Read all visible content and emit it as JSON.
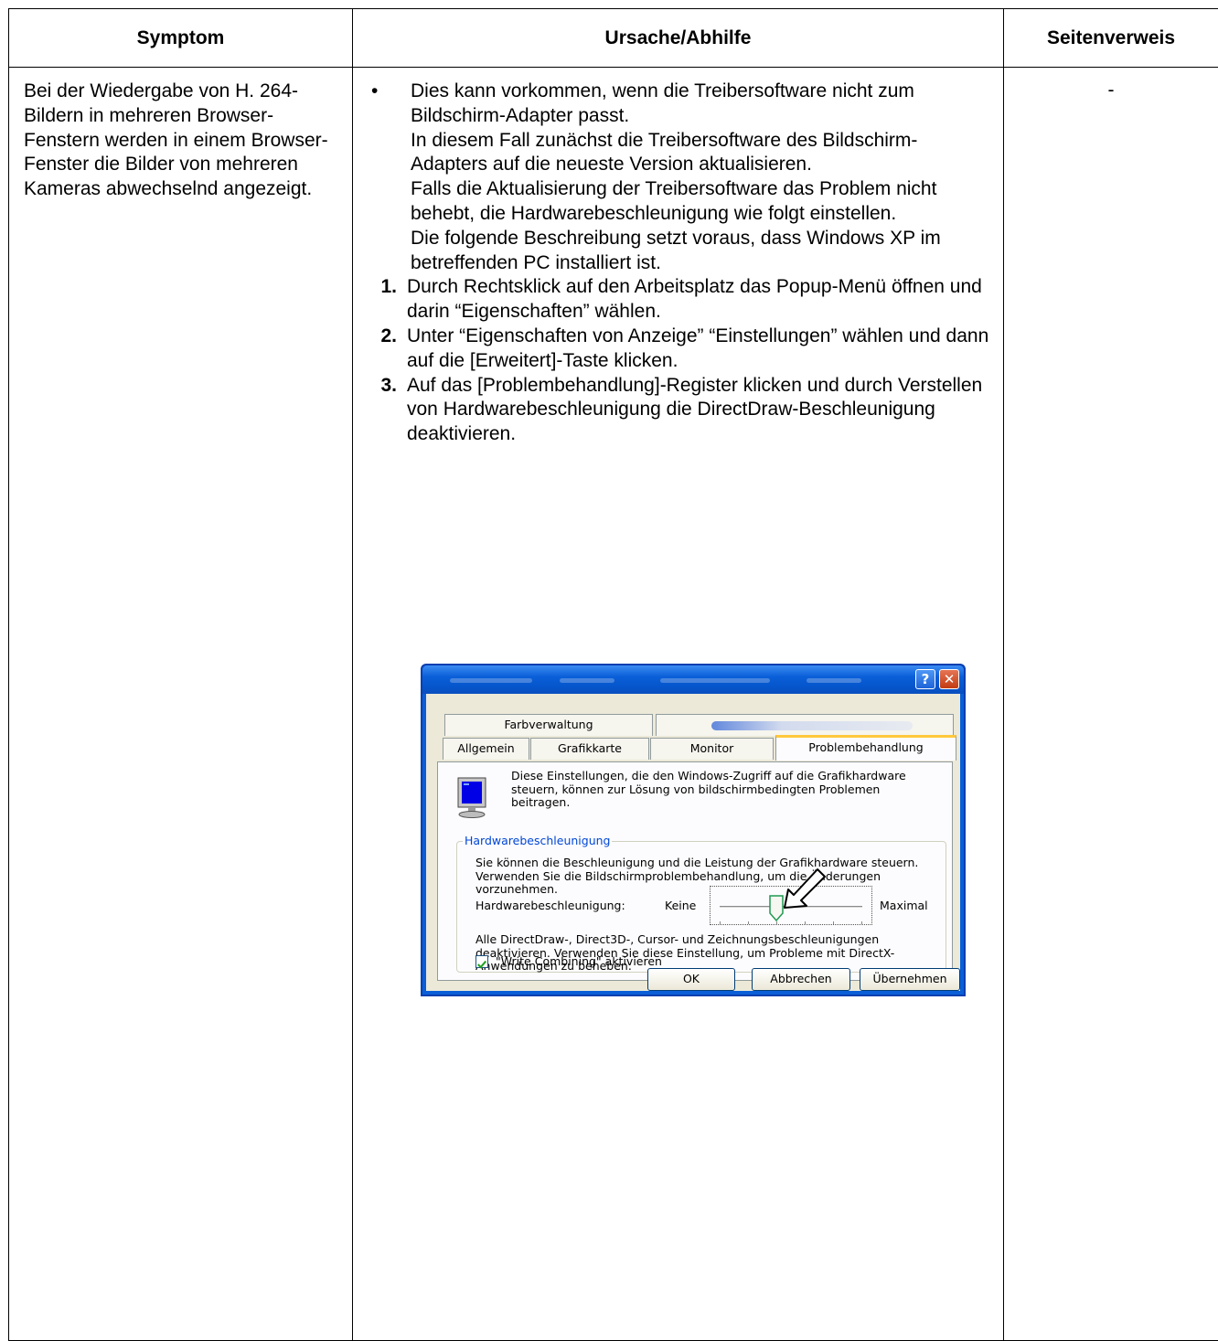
{
  "table": {
    "headers": {
      "symptom": "Symptom",
      "cause": "Ursache/Abhilfe",
      "reference": "Seitenverweis"
    },
    "row": {
      "symptom": "Bei der Wiedergabe von H. 264-Bildern in mehreren Browser-Fenstern werden in einem Browser-Fenster die Bilder von mehreren Kameras abwechselnd angezeigt.",
      "bullet": "•",
      "cause_paragraphs": [
        "Dies kann vorkommen, wenn die Treibersoftware nicht zum Bildschirm-Adapter passt.",
        "In diesem Fall zunächst die Treibersoftware des Bildschirm-Adapters auf die neueste Version aktualisieren.",
        "Falls die Aktualisierung der Treibersoftware das Problem nicht behebt, die Hardwarebeschleunigung wie folgt einstellen.",
        "Die folgende Beschreibung setzt voraus, dass Windows XP im betreffenden PC installiert ist."
      ],
      "steps": [
        {
          "num": "1.",
          "text": "Durch Rechtsklick auf den Arbeitsplatz das Popup-Menü öffnen und darin “Eigenschaften” wählen."
        },
        {
          "num": "2.",
          "text": "Unter “Eigenschaften von Anzeige” “Einstellungen” wählen und dann auf die [Erweitert]-Taste klicken."
        },
        {
          "num": "3.",
          "text": "Auf das [Problembehandlung]-Register klicken und durch Verstellen von Hardwarebeschleunigung die DirectDraw-Beschleunigung deaktivieren."
        }
      ],
      "reference": "-"
    }
  },
  "dialog": {
    "title_buttons": {
      "help": "?",
      "close": "✕"
    },
    "tabs_top": [
      "Farbverwaltung",
      ""
    ],
    "tabs_bottom": [
      "Allgemein",
      "Grafikkarte",
      "Monitor",
      "Problembehandlung"
    ],
    "active_tab": "Problembehandlung",
    "intro": "Diese Einstellungen, die den Windows-Zugriff auf die Grafikhardware steuern, können zur Lösung von bildschirmbedingten Problemen beitragen.",
    "group_title": "Hardwarebeschleunigung",
    "group_text": "Sie können die Beschleunigung und die Leistung der Grafikhardware steuern. Verwenden Sie die Bildschirmproblembehandlung, um die Änderungen vorzunehmen.",
    "accel_label": "Hardwarebeschleunigung:",
    "slider_min_label": "Keine",
    "slider_max_label": "Maximal",
    "slider_level": 0.4,
    "disable_text": "Alle DirectDraw-, Direct3D-, Cursor- und Zeichnungsbeschleunigungen deaktivieren. Verwenden Sie diese Einstellung, um Probleme mit DirectX-Anwendungen zu beheben.",
    "write_combining_label": "\"Write Combining\" aktivieren",
    "write_combining_checked": true,
    "buttons": {
      "ok": "OK",
      "cancel": "Abbrechen",
      "apply": "Übernehmen"
    },
    "colors": {
      "title_blue": "#0a5fd8",
      "client": "#ece9d8",
      "active_tab_highlight": "#ffc83c",
      "group_title": "#0046d5"
    },
    "icons": [
      "monitor-icon",
      "help-icon",
      "close-icon",
      "mouse-arrow-icon",
      "checkmark-icon"
    ]
  }
}
